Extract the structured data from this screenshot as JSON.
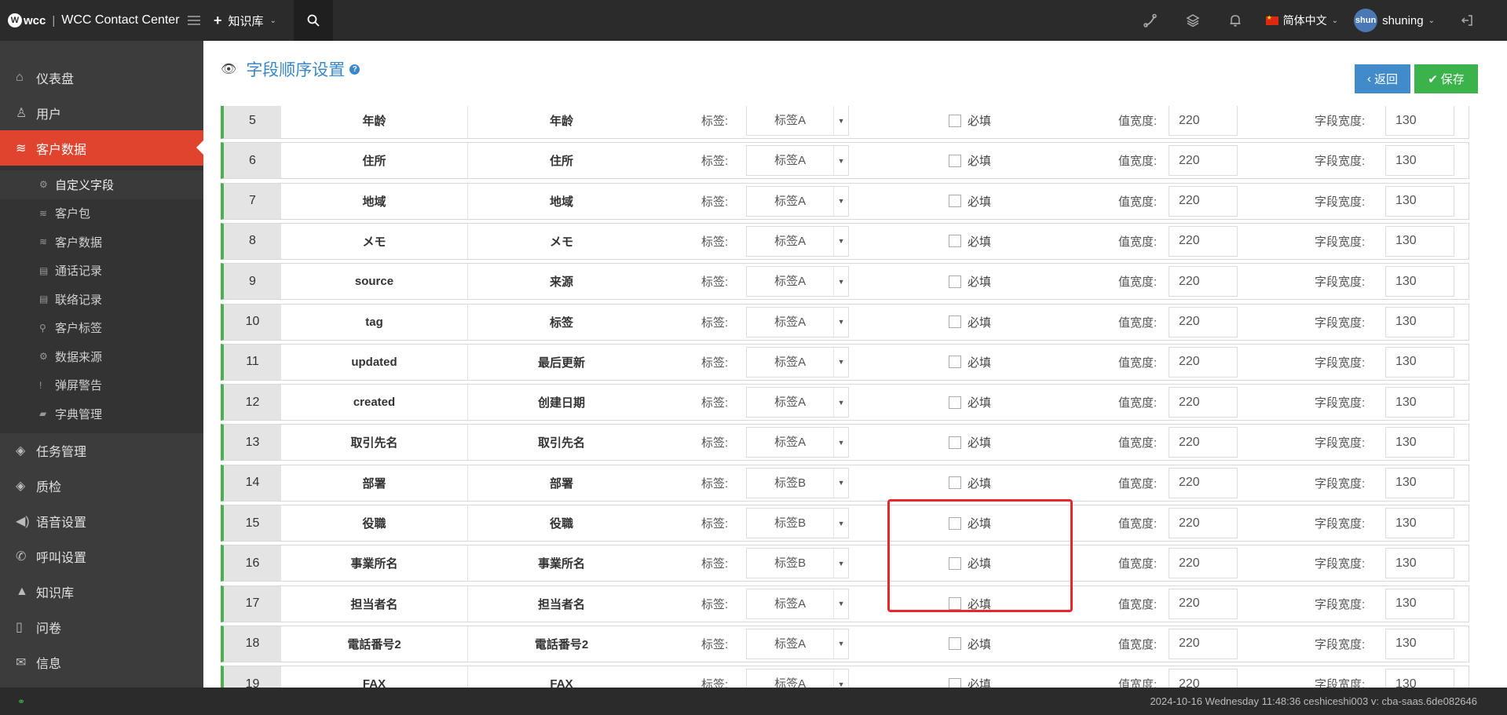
{
  "topbar": {
    "logo_text": "wcc",
    "title": "WCC Contact Center",
    "kb_menu": "知识库",
    "language": "简体中文",
    "avatar_text": "shun",
    "username": "shuning"
  },
  "sidebar": {
    "items": [
      {
        "label": "仪表盘",
        "icon": "home-icon"
      },
      {
        "label": "用户",
        "icon": "user-icon"
      },
      {
        "label": "客户数据",
        "icon": "database-icon",
        "active": true
      }
    ],
    "sub_items": [
      {
        "label": "自定义字段",
        "icon": "gear-icon",
        "active": true
      },
      {
        "label": "客户包",
        "icon": "database-icon"
      },
      {
        "label": "客户数据",
        "icon": "database-icon"
      },
      {
        "label": "通话记录",
        "icon": "clipboard-icon"
      },
      {
        "label": "联络记录",
        "icon": "clipboard-icon"
      },
      {
        "label": "客户标签",
        "icon": "link-icon"
      },
      {
        "label": "数据来源",
        "icon": "cogs-icon"
      },
      {
        "label": "弹屏警告",
        "icon": "exclamation-icon"
      },
      {
        "label": "字典管理",
        "icon": "book-icon"
      }
    ],
    "items_after": [
      {
        "label": "任务管理",
        "icon": "layers-icon"
      },
      {
        "label": "质检",
        "icon": "layers-icon"
      },
      {
        "label": "语音设置",
        "icon": "volume-icon"
      },
      {
        "label": "呼叫设置",
        "icon": "phone-icon"
      },
      {
        "label": "知识库",
        "icon": "graduation-cap-icon"
      },
      {
        "label": "问卷",
        "icon": "file-icon"
      },
      {
        "label": "信息",
        "icon": "envelope-icon"
      }
    ]
  },
  "page": {
    "title": "字段顺序设置",
    "help": "?",
    "back_button": "返回",
    "save_button": "保存"
  },
  "table": {
    "tag_label": "标签:",
    "required_label": "必填",
    "value_width_label": "值宽度:",
    "field_width_label": "字段宽度:",
    "rows": [
      {
        "index": "5",
        "name": "年龄",
        "label": "年龄",
        "tag": "标签A",
        "value_width": "220",
        "field_width": "130"
      },
      {
        "index": "6",
        "name": "住所",
        "label": "住所",
        "tag": "标签A",
        "value_width": "220",
        "field_width": "130"
      },
      {
        "index": "7",
        "name": "地域",
        "label": "地域",
        "tag": "标签A",
        "value_width": "220",
        "field_width": "130"
      },
      {
        "index": "8",
        "name": "メモ",
        "label": "メモ",
        "tag": "标签A",
        "value_width": "220",
        "field_width": "130"
      },
      {
        "index": "9",
        "name": "source",
        "label": "来源",
        "tag": "标签A",
        "value_width": "220",
        "field_width": "130"
      },
      {
        "index": "10",
        "name": "tag",
        "label": "标签",
        "tag": "标签A",
        "value_width": "220",
        "field_width": "130"
      },
      {
        "index": "11",
        "name": "updated",
        "label": "最后更新",
        "tag": "标签A",
        "value_width": "220",
        "field_width": "130"
      },
      {
        "index": "12",
        "name": "created",
        "label": "创建日期",
        "tag": "标签A",
        "value_width": "220",
        "field_width": "130"
      },
      {
        "index": "13",
        "name": "取引先名",
        "label": "取引先名",
        "tag": "标签A",
        "value_width": "220",
        "field_width": "130"
      },
      {
        "index": "14",
        "name": "部署",
        "label": "部署",
        "tag": "标签B",
        "value_width": "220",
        "field_width": "130"
      },
      {
        "index": "15",
        "name": "役職",
        "label": "役職",
        "tag": "标签B",
        "value_width": "220",
        "field_width": "130"
      },
      {
        "index": "16",
        "name": "事業所名",
        "label": "事業所名",
        "tag": "标签B",
        "value_width": "220",
        "field_width": "130"
      },
      {
        "index": "17",
        "name": "担当者名",
        "label": "担当者名",
        "tag": "标签A",
        "value_width": "220",
        "field_width": "130"
      },
      {
        "index": "18",
        "name": "電話番号2",
        "label": "電話番号2",
        "tag": "标签A",
        "value_width": "220",
        "field_width": "130"
      },
      {
        "index": "19",
        "name": "FAX",
        "label": "FAX",
        "tag": "标签A",
        "value_width": "220",
        "field_width": "130"
      }
    ]
  },
  "footer": {
    "info": "2024-10-16 Wednesday 11:48:36   ceshiceshi003   v: cba-saas.6de082646"
  },
  "colors": {
    "accent_red": "#e0442f",
    "primary_blue": "#428bca",
    "success_green": "#3bb34a",
    "row_marker_green": "#4caf50",
    "highlight_red": "#e8262d"
  }
}
